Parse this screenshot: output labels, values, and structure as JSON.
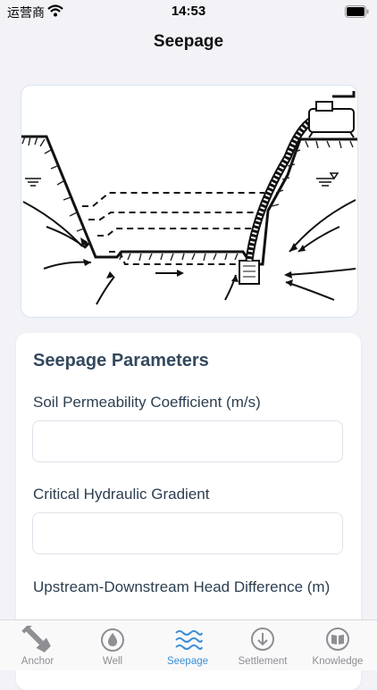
{
  "status_bar": {
    "carrier": "运营商",
    "time": "14:53"
  },
  "nav": {
    "title": "Seepage"
  },
  "parameters": {
    "title": "Seepage Parameters",
    "fields": [
      {
        "label": "Soil Permeability Coefficient (m/s)",
        "value": "",
        "placeholder": ""
      },
      {
        "label": "Critical Hydraulic Gradient",
        "value": "",
        "placeholder": ""
      },
      {
        "label": "Upstream-Downstream Head Difference (m)",
        "value": "",
        "placeholder": ""
      }
    ]
  },
  "tabs": [
    {
      "label": "Anchor",
      "icon": "anchor-shovel-icon",
      "active": false
    },
    {
      "label": "Well",
      "icon": "water-drop-icon",
      "active": false
    },
    {
      "label": "Seepage",
      "icon": "waves-icon",
      "active": true
    },
    {
      "label": "Settlement",
      "icon": "arrow-down-circle-icon",
      "active": false
    },
    {
      "label": "Knowledge",
      "icon": "book-icon",
      "active": false
    }
  ],
  "colors": {
    "accent": "#3a8fd6",
    "inactive": "#8e8e93",
    "heading": "#34495e"
  }
}
